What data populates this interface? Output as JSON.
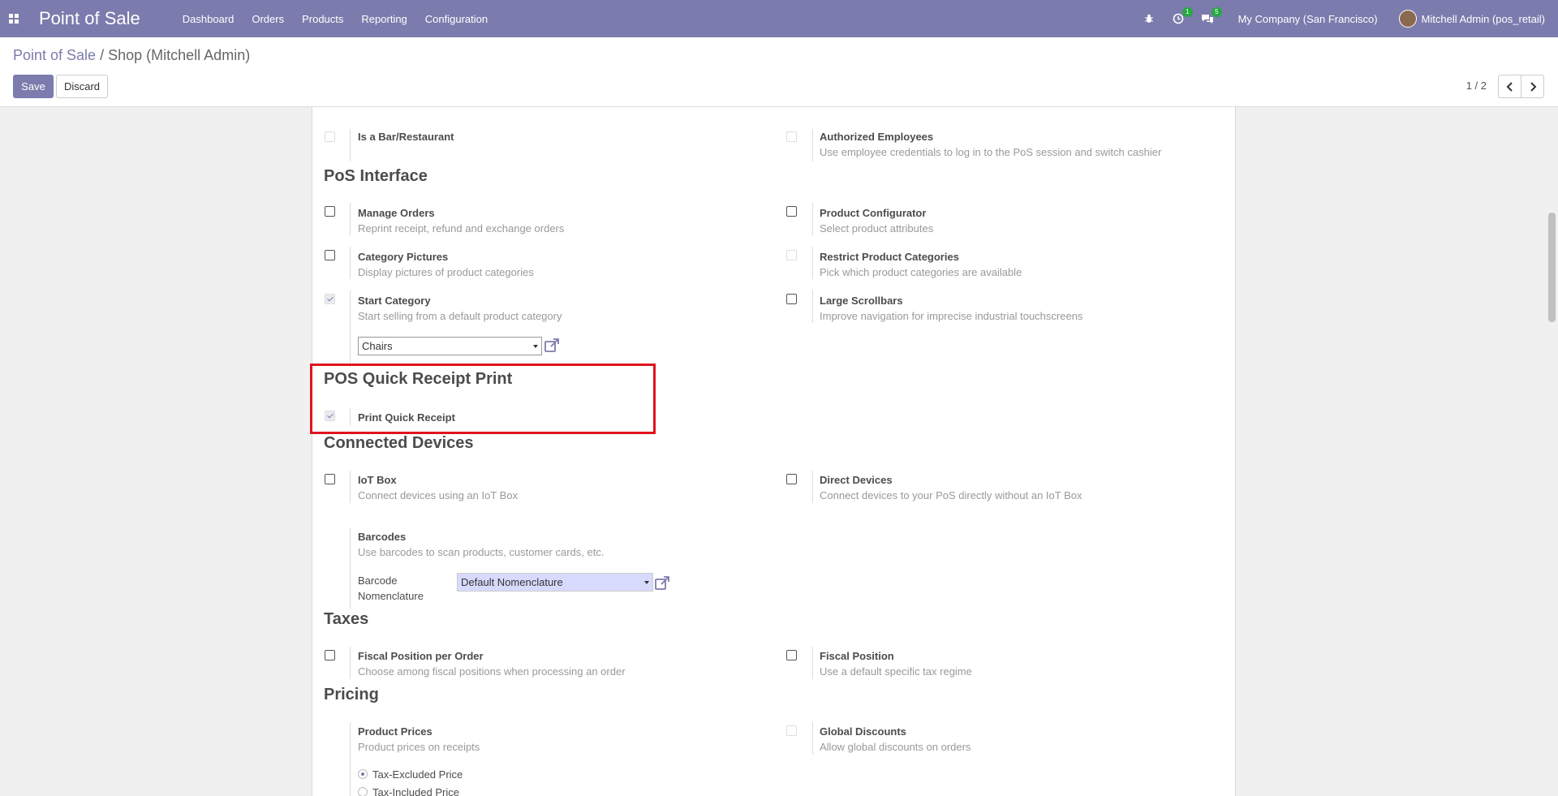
{
  "navbar": {
    "brand": "Point of Sale",
    "menu": [
      "Dashboard",
      "Orders",
      "Products",
      "Reporting",
      "Configuration"
    ],
    "activity_count": "1",
    "message_count": "5",
    "company": "My Company (San Francisco)",
    "user": "Mitchell Admin (pos_retail)"
  },
  "breadcrumb": {
    "root": "Point of Sale",
    "separator": "/",
    "current": "Shop (Mitchell Admin)"
  },
  "actions": {
    "save": "Save",
    "discard": "Discard"
  },
  "pager": {
    "text": "1 / 2"
  },
  "settings": {
    "bar_restaurant": {
      "title": "Is a Bar/Restaurant"
    },
    "authorized_employees": {
      "title": "Authorized Employees",
      "desc": "Use employee credentials to log in to the PoS session and switch cashier"
    },
    "manage_orders": {
      "title": "Manage Orders",
      "desc": "Reprint receipt, refund and exchange orders"
    },
    "product_configurator": {
      "title": "Product Configurator",
      "desc": "Select product attributes"
    },
    "category_pictures": {
      "title": "Category Pictures",
      "desc": "Display pictures of product categories"
    },
    "restrict_categories": {
      "title": "Restrict Product Categories",
      "desc": "Pick which product categories are available"
    },
    "start_category": {
      "title": "Start Category",
      "desc": "Start selling from a default product category",
      "value": "Chairs"
    },
    "large_scrollbars": {
      "title": "Large Scrollbars",
      "desc": "Improve navigation for imprecise industrial touchscreens"
    },
    "print_quick_receipt": {
      "title": "Print Quick Receipt"
    },
    "iot_box": {
      "title": "IoT Box",
      "desc": "Connect devices using an IoT Box"
    },
    "direct_devices": {
      "title": "Direct Devices",
      "desc": "Connect devices to your PoS directly without an IoT Box"
    },
    "barcodes": {
      "title": "Barcodes",
      "desc": "Use barcodes to scan products, customer cards, etc.",
      "nomenclature_label_1": "Barcode",
      "nomenclature_label_2": "Nomenclature",
      "nomenclature_value": "Default Nomenclature"
    },
    "fiscal_position_per_order": {
      "title": "Fiscal Position per Order",
      "desc": "Choose among fiscal positions when processing an order"
    },
    "fiscal_position": {
      "title": "Fiscal Position",
      "desc": "Use a default specific tax regime"
    },
    "product_prices": {
      "title": "Product Prices",
      "desc": "Product prices on receipts",
      "option_excluded": "Tax-Excluded Price",
      "option_included": "Tax-Included Price"
    },
    "global_discounts": {
      "title": "Global Discounts",
      "desc": "Allow global discounts on orders"
    }
  },
  "sections": {
    "pos_interface": "PoS Interface",
    "quick_receipt": "POS Quick Receipt Print",
    "connected_devices": "Connected Devices",
    "taxes": "Taxes",
    "pricing": "Pricing"
  }
}
